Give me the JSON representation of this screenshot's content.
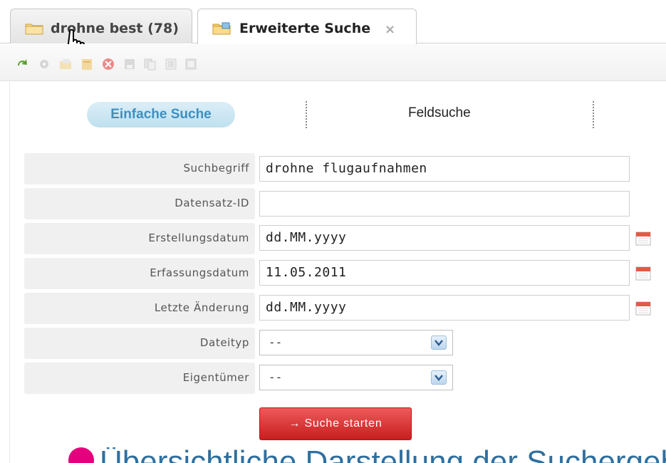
{
  "tabs": [
    {
      "label": "drohne best (78)",
      "active": false,
      "icon": "folder-icon"
    },
    {
      "label": "Erweiterte Suche",
      "active": true,
      "icon": "folder-search-icon",
      "close": "×"
    }
  ],
  "toolbar": {
    "icons": [
      "refresh-icon",
      "settings-icon",
      "open-icon",
      "export-icon",
      "delete-icon",
      "save-icon",
      "copy-icon",
      "list-icon",
      "window-icon"
    ]
  },
  "subtabs": {
    "active": "Einfache Suche",
    "other": "Feldsuche"
  },
  "form": {
    "suchbegriff": {
      "label": "Suchbegriff",
      "value": "drohne flugaufnahmen"
    },
    "datensatz_id": {
      "label": "Datensatz-ID",
      "value": ""
    },
    "erstellungsdatum": {
      "label": "Erstellungsdatum",
      "value": "dd.MM.yyyy"
    },
    "erfassungsdatum": {
      "label": "Erfassungsdatum",
      "value": "11.05.2011"
    },
    "letzte_aenderung": {
      "label": "Letzte Änderung",
      "value": "dd.MM.yyyy"
    },
    "dateityp": {
      "label": "Dateityp",
      "value": "--"
    },
    "eigentuemer": {
      "label": "Eigentümer",
      "value": "--"
    }
  },
  "search_button": "→ Suche starten",
  "footer": {
    "text": "Übersichtliche Darstellung der Suchergebnisse"
  },
  "colors": {
    "accent_blue": "#3f8fc0",
    "button_red": "#d93030",
    "footer_pink": "#e5007d"
  }
}
